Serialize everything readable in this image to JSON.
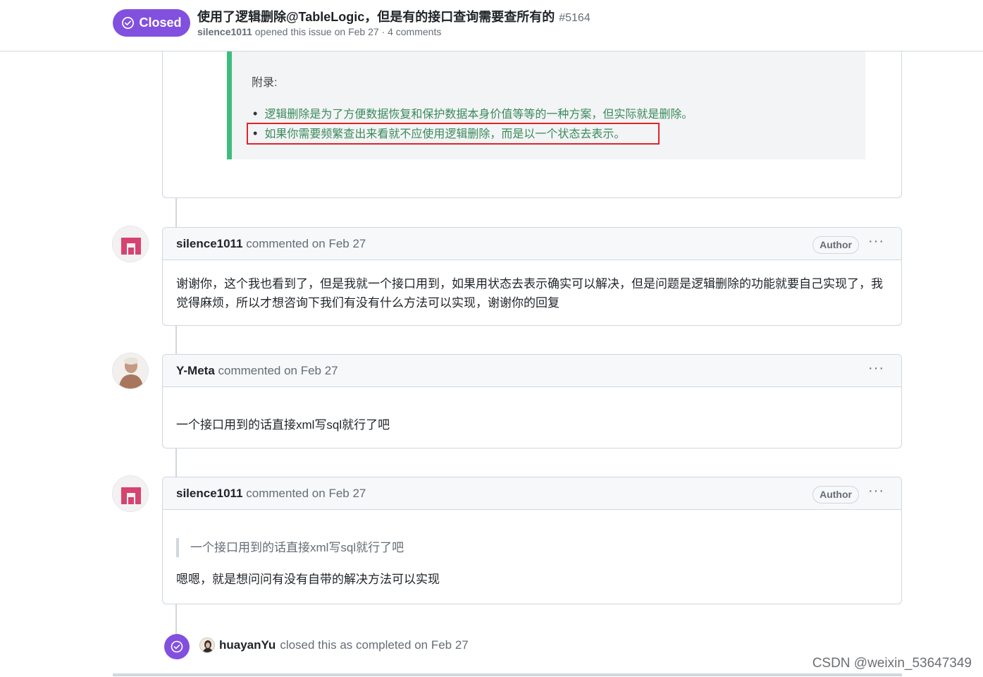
{
  "header": {
    "state_label": "Closed",
    "title": "使用了逻辑删除@TableLogic，但是有的接口查询需要查所有的",
    "number": "#5164",
    "meta_author": "silence1011",
    "meta_rest": "opened this issue on Feb 27 · 4 comments"
  },
  "embedded_image": {
    "appendix": "附录:",
    "bullet_1": "逻辑删除是为了方便数据恢复和保护数据本身价值等等的一种方案，但实际就是删除。",
    "bullet_2": "如果你需要频繁查出来看就不应使用逻辑删除，而是以一个状态去表示。"
  },
  "comments": [
    {
      "author": "silence1011",
      "action": "commented on Feb 27",
      "author_label": "Author",
      "menu": "···",
      "body": "谢谢你，这个我也看到了，但是我就一个接口用到，如果用状态去表示确实可以解决，但是问题是逻辑删除的功能就要自己实现了，我觉得麻烦，所以才想咨询下我们有没有什么方法可以实现，谢谢你的回复"
    },
    {
      "author": "Y-Meta",
      "action": "commented on Feb 27",
      "menu": "···",
      "body": "一个接口用到的话直接xml写sql就行了吧"
    },
    {
      "author": "silence1011",
      "action": "commented on Feb 27",
      "author_label": "Author",
      "menu": "···",
      "quote": "一个接口用到的话直接xml写sql就行了吧",
      "body": "嗯嗯，就是想问问有没有自带的解决方法可以实现"
    }
  ],
  "closed_event": {
    "actor": "huayanYu",
    "text": "closed this as completed on Feb 27"
  },
  "watermark": "CSDN @weixin_53647349",
  "colors": {
    "closed_purple": "#8250df",
    "border": "#d0d7de",
    "muted_text": "#656d76",
    "highlight_red": "#e0242b",
    "quote_bar_green": "#3dbd7d"
  }
}
